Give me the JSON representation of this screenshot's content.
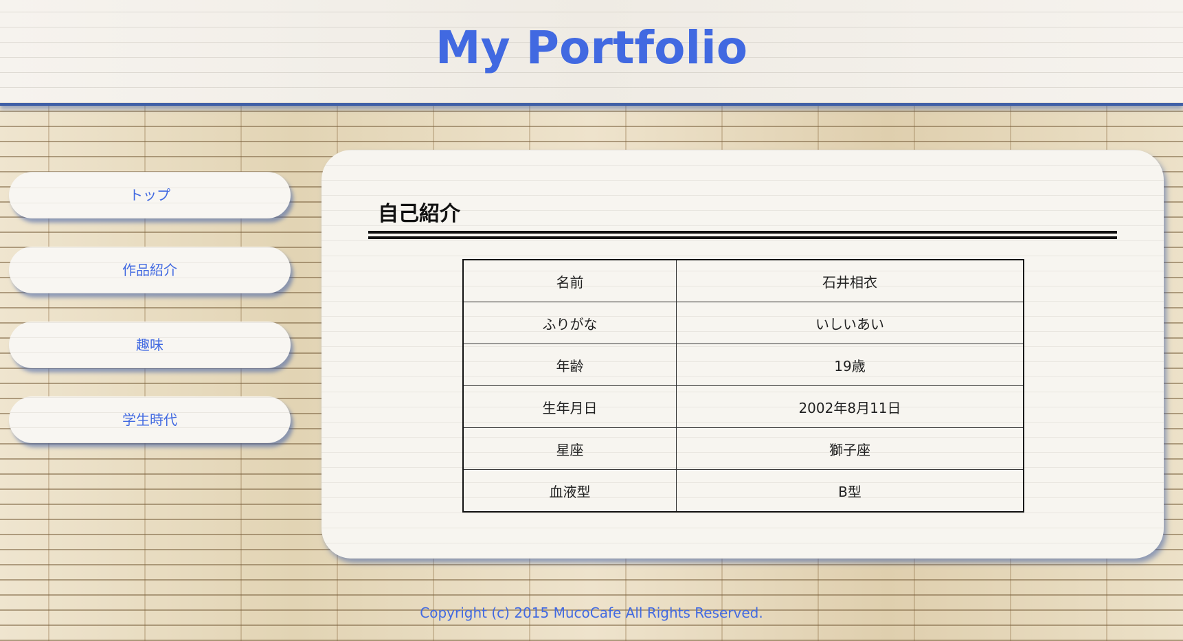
{
  "header": {
    "title": "My Portfolio"
  },
  "nav": {
    "items": [
      {
        "label": "トップ"
      },
      {
        "label": "作品紹介"
      },
      {
        "label": "趣味"
      },
      {
        "label": "学生時代"
      }
    ]
  },
  "main": {
    "section_title": "自己紹介",
    "table": {
      "rows": [
        {
          "label": "名前",
          "value": "石井相衣"
        },
        {
          "label": "ふりがな",
          "value": "いしいあい"
        },
        {
          "label": "年齢",
          "value": "19歳"
        },
        {
          "label": "生年月日",
          "value": "2002年8月11日"
        },
        {
          "label": "星座",
          "value": "獅子座"
        },
        {
          "label": "血液型",
          "value": "B型"
        }
      ]
    }
  },
  "footer": {
    "copyright": "Copyright (c) 2015 MucoCafe All Rights Reserved."
  },
  "colors": {
    "accent": "#4169e1",
    "header_border": "#3f5fa6"
  }
}
